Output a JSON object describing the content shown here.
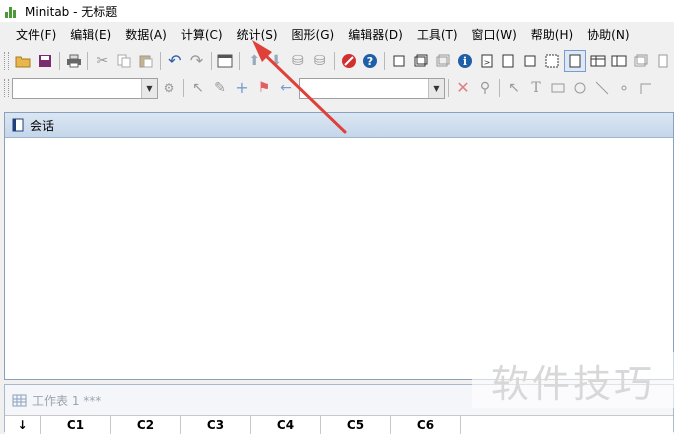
{
  "app": {
    "title": "Minitab - 无标题"
  },
  "menu": [
    {
      "label": "文件(F)"
    },
    {
      "label": "编辑(E)"
    },
    {
      "label": "数据(A)"
    },
    {
      "label": "计算(C)"
    },
    {
      "label": "统计(S)"
    },
    {
      "label": "图形(G)"
    },
    {
      "label": "编辑器(D)"
    },
    {
      "label": "工具(T)"
    },
    {
      "label": "窗口(W)"
    },
    {
      "label": "帮助(H)"
    },
    {
      "label": "协助(N)"
    }
  ],
  "session": {
    "title": "会话"
  },
  "worksheet": {
    "title": "工作表 1 ***",
    "row_header": "↓",
    "columns": [
      "C1",
      "C2",
      "C3",
      "C4",
      "C5",
      "C6"
    ]
  },
  "watermark": {
    "text": "软件技巧"
  },
  "colors": {
    "arrow": "#e0403a",
    "accent_red": "#d03030",
    "help_blue": "#1f5fa8"
  }
}
